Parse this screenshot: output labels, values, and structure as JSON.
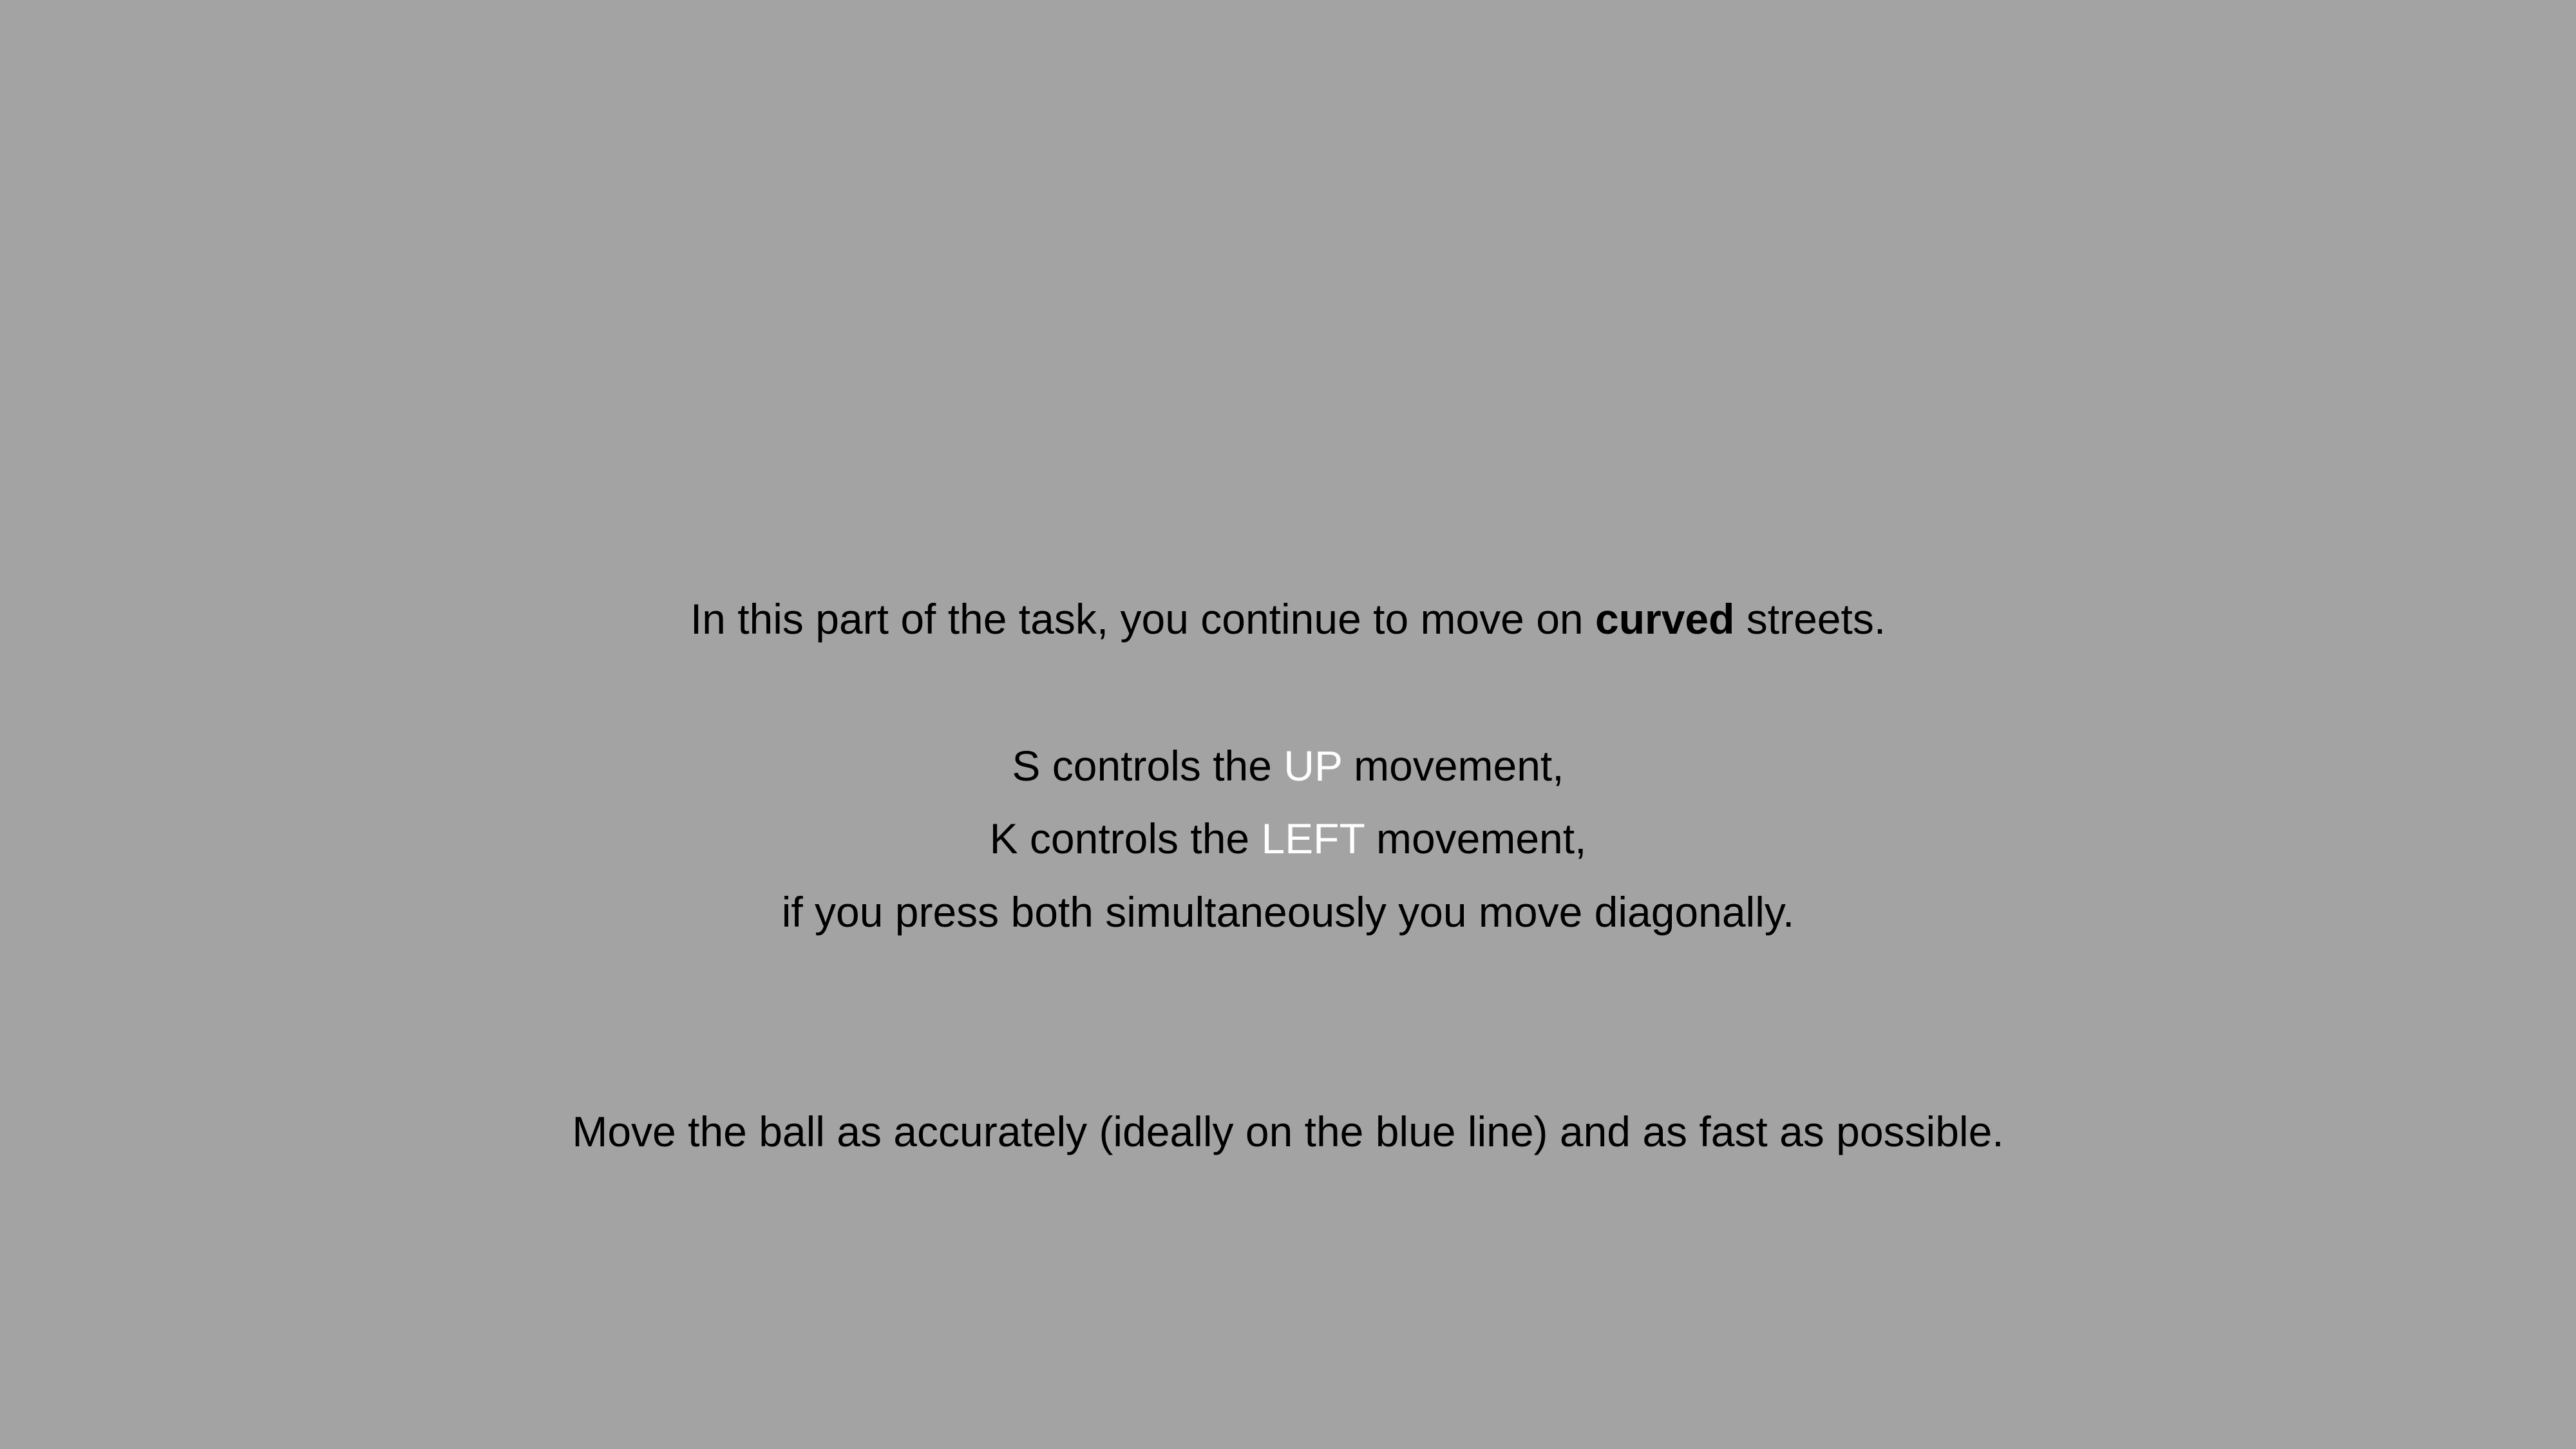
{
  "instructions": {
    "intro": {
      "before": "In this part of the task, you continue to move on ",
      "emphasis": "curved",
      "after": " streets."
    },
    "control_up": {
      "before": "S controls the ",
      "highlight": "UP",
      "after": " movement,"
    },
    "control_left": {
      "before": "K controls the ",
      "highlight": "LEFT",
      "after": " movement,"
    },
    "diagonal": "if you press both simultaneously you move diagonally.",
    "goal": "Move the ball as accurately (ideally on the blue line) and as fast as possible."
  },
  "colors": {
    "background": "#a3a3a3",
    "text": "#000000",
    "highlight": "#ffffff"
  }
}
